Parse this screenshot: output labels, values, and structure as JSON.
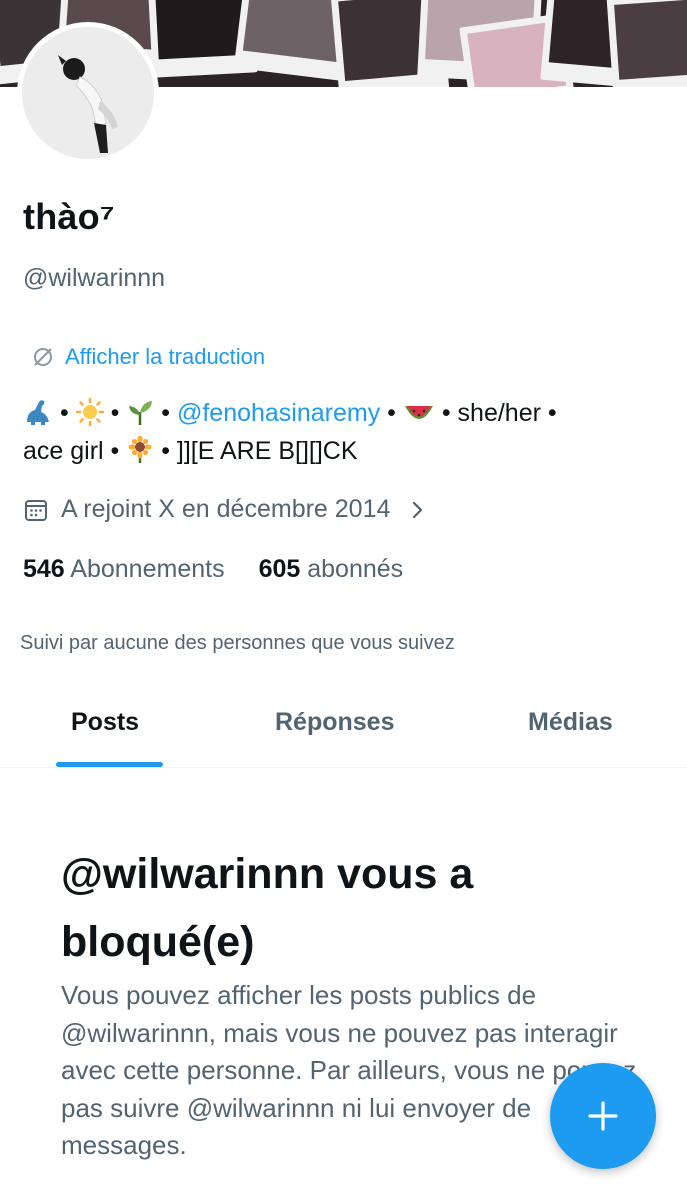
{
  "profile": {
    "display_name": "thào⁷",
    "handle": "@wilwarinnn",
    "translate_label": "Afficher la traduction",
    "bio": {
      "sep": " • ",
      "mention": "@fenohasinaremy",
      "pronouns": "she/her",
      "line2_text": "ace girl",
      "tail": "]][E ARE B[][]CK",
      "emojis": [
        "dinosaur",
        "sun",
        "seedling",
        "watermelon",
        "sunflower"
      ]
    },
    "joined": "A rejoint X en décembre 2014",
    "following_count": "546",
    "following_label": "Abonnements",
    "followers_count": "605",
    "followers_label": "abonnés",
    "followed_by": "Suivi par aucune des personnes que vous suivez"
  },
  "tabs": [
    {
      "label": "Posts",
      "active": true
    },
    {
      "label": "Réponses",
      "active": false
    },
    {
      "label": "Médias",
      "active": false
    }
  ],
  "blocked": {
    "title": "@wilwarinnn vous a bloqué(e)",
    "text": "Vous pouvez afficher les posts publics de @wilwarinnn, mais vous ne pouvez pas interagir avec cette personne. Par ailleurs, vous ne pouvez pas suivre @wilwarinnn ni lui envoyer de messages."
  },
  "icons": {
    "translate": "translate-icon",
    "calendar": "calendar-icon",
    "chevron": "chevron-right-icon",
    "compose": "plus-icon"
  },
  "colors": {
    "accent": "#1d9bf0",
    "text": "#0f1419",
    "secondary": "#536471"
  }
}
